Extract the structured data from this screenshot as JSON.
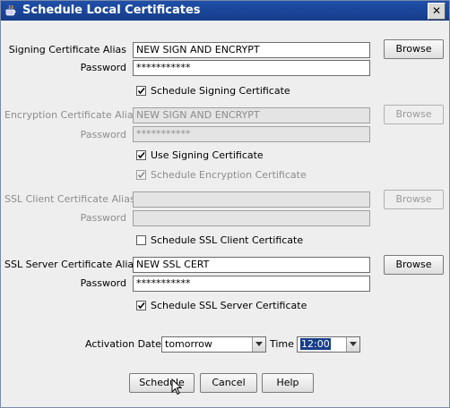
{
  "window": {
    "title": "Schedule Local Certificates",
    "close_glyph": "✕"
  },
  "signing": {
    "alias_label": "Signing Certificate Alias",
    "alias_value": "NEW SIGN AND ENCRYPT",
    "password_label": "Password",
    "password_value": "***********",
    "browse_label": "Browse",
    "schedule_check": {
      "label": "Schedule Signing Certificate",
      "checked": true,
      "enabled": true
    }
  },
  "encryption": {
    "alias_label": "Encryption Certificate Alias",
    "alias_value": "NEW SIGN AND ENCRYPT",
    "password_label": "Password",
    "password_value": "***********",
    "browse_label": "Browse",
    "use_signing_check": {
      "label": "Use Signing Certificate",
      "checked": true,
      "enabled": true
    },
    "schedule_check": {
      "label": "Schedule Encryption Certificate",
      "checked": true,
      "enabled": false
    }
  },
  "ssl_client": {
    "alias_label": "SSL Client Certificate Alias",
    "alias_value": "",
    "password_label": "Password",
    "password_value": "",
    "browse_label": "Browse",
    "schedule_check": {
      "label": "Schedule SSL Client Certificate",
      "checked": false,
      "enabled": true
    }
  },
  "ssl_server": {
    "alias_label": "SSL Server Certificate Alias",
    "alias_value": "NEW SSL CERT",
    "password_label": "Password",
    "password_value": "***********",
    "browse_label": "Browse",
    "schedule_check": {
      "label": "Schedule SSL Server Certificate",
      "checked": true,
      "enabled": true
    }
  },
  "activation": {
    "date_label": "Activation Date",
    "date_value": "tomorrow",
    "time_label": "Time",
    "time_value": "12:00"
  },
  "buttons": {
    "schedule": "Schedule",
    "cancel": "Cancel",
    "help": "Help"
  },
  "colors": {
    "title_bar": "#1f4fa8",
    "window_bg": "#eeeeee",
    "selection": "#163d8a",
    "disabled_text": "#8d8d8d"
  },
  "icons": {
    "app": "java-cup-icon",
    "close": "close-icon",
    "dropdown": "chevron-down-icon",
    "cursor": "mouse-pointer-icon"
  }
}
